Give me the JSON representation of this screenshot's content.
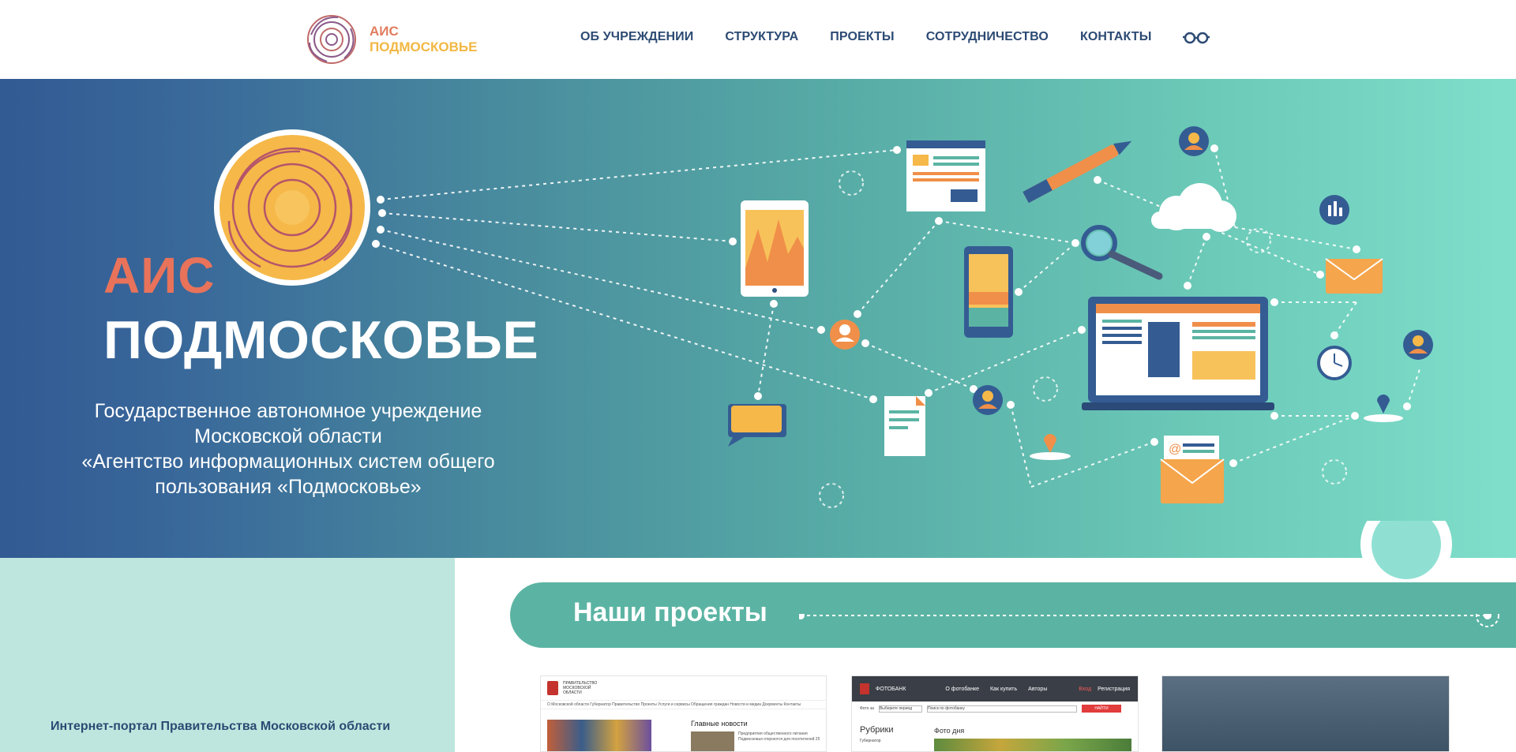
{
  "header": {
    "logo_line1": "АИС",
    "logo_line2": "ПОДМОСКОВЬЕ",
    "nav": [
      "ОБ УЧРЕЖДЕНИИ",
      "СТРУКТУРА",
      "ПРОЕКТЫ",
      "СОТРУДНИЧЕСТВО",
      "КОНТАКТЫ"
    ],
    "accessibility_icon": "glasses-icon"
  },
  "hero": {
    "title_line1": "АИС",
    "title_line2": "ПОДМОСКОВЬЕ",
    "subtitle_line1": "Государственное автономное учреждение",
    "subtitle_line2": "Московской области",
    "subtitle_line3": "«Агентство информационных систем общего",
    "subtitle_line4": "пользования «Подмосковье»"
  },
  "projects": {
    "title": "Наши проекты",
    "portal_title": "Интернет-портал Правительства Московской области",
    "thumb1": {
      "brand": "ПРАВИТЕЛЬСТВО МОСКОВСКОЙ ОБЛАСТИ",
      "menu": "О Московской области   Губернатор   Правительство   Проекты   Услуги и сервисы   Обращения граждан   Новости и медиа   Документы   Контакты",
      "news_heading": "Главные новости",
      "news_text": "Предприятия общественного питания Подмосковья откроются для посетителей 25"
    },
    "thumb2": {
      "brand": "ФОТОБАНК",
      "menu": [
        "О фотобанке",
        "Как купить",
        "Авторы"
      ],
      "login": "Вход",
      "register": "Регистрация",
      "filter_label": "Фото за",
      "period": "Выберите период",
      "search_placeholder": "Поиск по фотобанку",
      "search_button": "НАЙТИ",
      "rubrics": "Рубрики",
      "rubric_item": "Губернатор",
      "photo_of_day": "Фото дня"
    }
  },
  "colors": {
    "nav_text": "#2c4a73",
    "logo_orange": "#e07d5e",
    "logo_yellow": "#f2b743",
    "teal": "#5bb4a3",
    "hero_left": "#325a93",
    "hero_right": "#7fdfcb"
  }
}
